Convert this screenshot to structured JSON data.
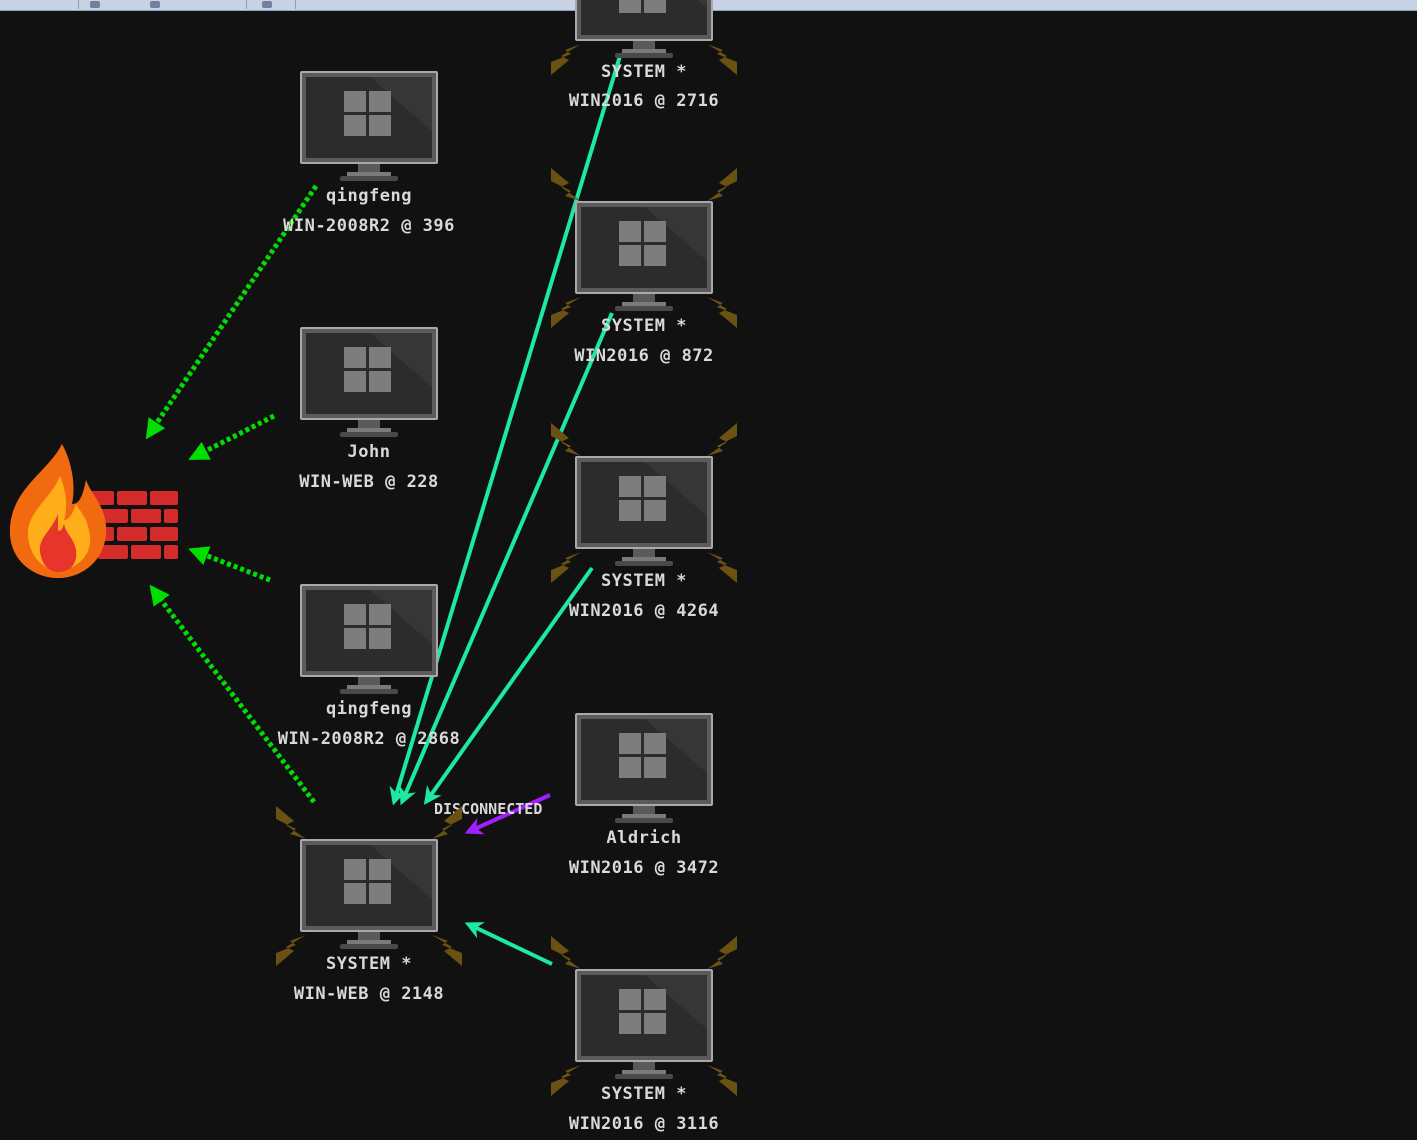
{
  "colors": {
    "background": "#111111",
    "pivot_link": "#00e000",
    "session_link": "#1de9a0",
    "disconnected_link": "#a11fff",
    "lightning": "#7a5c10",
    "label": "#d9d9d9"
  },
  "icons": {
    "listener": "firewall-fire-icon",
    "beacon": "windows-monitor-icon",
    "elevated": "lightning-icon"
  },
  "nodes": {
    "system_2716": {
      "user": "SYSTEM *",
      "host": "WIN2016 @ 2716"
    },
    "qingfeng_396": {
      "user": "qingfeng",
      "host": "WIN-2008R2 @ 396"
    },
    "system_872": {
      "user": "SYSTEM *",
      "host": "WIN2016 @ 872"
    },
    "john_228": {
      "user": "John",
      "host": "WIN-WEB @ 228"
    },
    "system_4264": {
      "user": "SYSTEM *",
      "host": "WIN2016 @ 4264"
    },
    "qingfeng_2868": {
      "user": "qingfeng",
      "host": "WIN-2008R2 @ 2868"
    },
    "aldrich_3472": {
      "user": "Aldrich",
      "host": "WIN2016 @ 3472"
    },
    "system_2148": {
      "user": "SYSTEM *",
      "host": "WIN-WEB @ 2148"
    },
    "system_3116": {
      "user": "SYSTEM *",
      "host": "WIN2016 @ 3116"
    }
  },
  "edges": {
    "disconnected_label": "DISCONNECTED"
  }
}
